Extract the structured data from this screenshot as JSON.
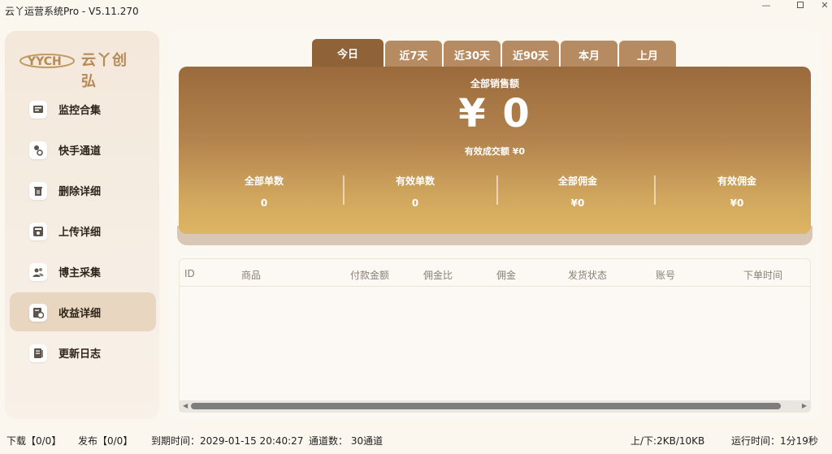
{
  "window": {
    "title": "云丫运营系统Pro - V5.11.270",
    "minimize": "—",
    "close": "✕"
  },
  "sidebar": {
    "logo_mark": "YYCH",
    "logo_text": "云丫创弘",
    "items": [
      {
        "label": "监控合集",
        "icon": "monitor-icon"
      },
      {
        "label": "快手通道",
        "icon": "channel-icon"
      },
      {
        "label": "删除详细",
        "icon": "trash-icon"
      },
      {
        "label": "上传详细",
        "icon": "upload-icon"
      },
      {
        "label": "博主采集",
        "icon": "users-icon"
      },
      {
        "label": "收益详细",
        "icon": "earnings-icon",
        "active": true
      },
      {
        "label": "更新日志",
        "icon": "log-icon"
      }
    ]
  },
  "tabs": [
    "今日",
    "近7天",
    "近30天",
    "近90天",
    "本月",
    "上月"
  ],
  "summary": {
    "sales_label": "全部销售额",
    "sales_value": "¥ 0",
    "valid_line": "有效成交额 ¥0",
    "stats": [
      {
        "label": "全部单数",
        "value": "0"
      },
      {
        "label": "有效单数",
        "value": "0"
      },
      {
        "label": "全部佣金",
        "value": "¥0"
      },
      {
        "label": "有效佣金",
        "value": "¥0"
      }
    ]
  },
  "table": {
    "columns": [
      "ID",
      "商品",
      "付款金额",
      "佣金比",
      "佣金",
      "发货状态",
      "账号",
      "下单时间"
    ],
    "rows": []
  },
  "statusbar": {
    "download": "下载【0/0】",
    "publish": "发布【0/0】",
    "expire": "到期时间：2029-01-15 20:40:27",
    "channels": "通道数：  30通道",
    "traffic": "上/下:2KB/10KB",
    "runtime": "运行时间：1分19秒"
  },
  "colors": {
    "accent": "#8f6238",
    "tab": "#b68b61",
    "card_top": "#9a6a3c",
    "card_bottom": "#deb563",
    "active_nav": "#e8d6c0"
  }
}
